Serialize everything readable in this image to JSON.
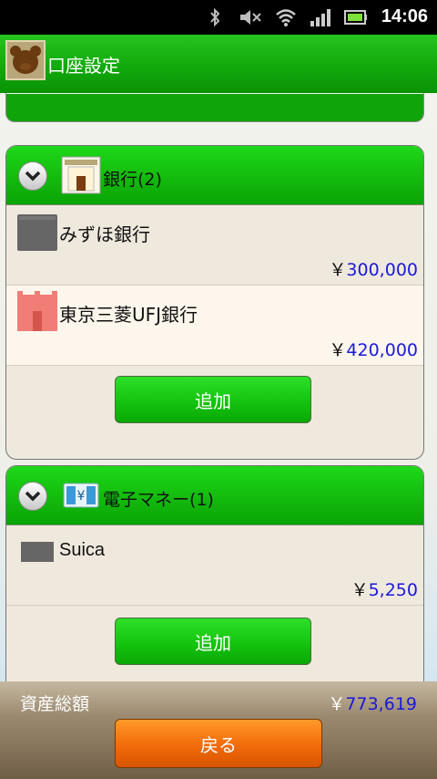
{
  "status_bar": {
    "time": "14:06",
    "icons": [
      "bluetooth-icon",
      "mute-icon",
      "wifi-icon",
      "signal-icon",
      "battery-icon"
    ]
  },
  "header": {
    "title": "口座設定",
    "avatar_icon": "bear-avatar-icon"
  },
  "sections": [
    {
      "title": "銀行(2)",
      "icon": "bank-building-icon",
      "accounts": [
        {
          "name": "みずほ銀行",
          "currency": "￥",
          "amount": "300,000",
          "icon": "bank-icon-gray"
        },
        {
          "name": "東京三菱UFJ銀行",
          "currency": "￥",
          "amount": "420,000",
          "icon": "bank-icon-red"
        }
      ],
      "add_label": "追加"
    },
    {
      "title": "電子マネー(1)",
      "icon": "emoney-card-icon",
      "accounts": [
        {
          "name": "Suica",
          "currency": "￥",
          "amount": "5,250",
          "icon": "card-icon-gray"
        }
      ],
      "add_label": "追加"
    }
  ],
  "footer": {
    "total_label": "資産総額",
    "total_currency": "￥",
    "total_value": "773,619",
    "back_label": "戻る"
  },
  "colors": {
    "header_green": "#12a90c",
    "amount_blue": "#1a1ad8",
    "back_orange": "#f26a0a"
  }
}
